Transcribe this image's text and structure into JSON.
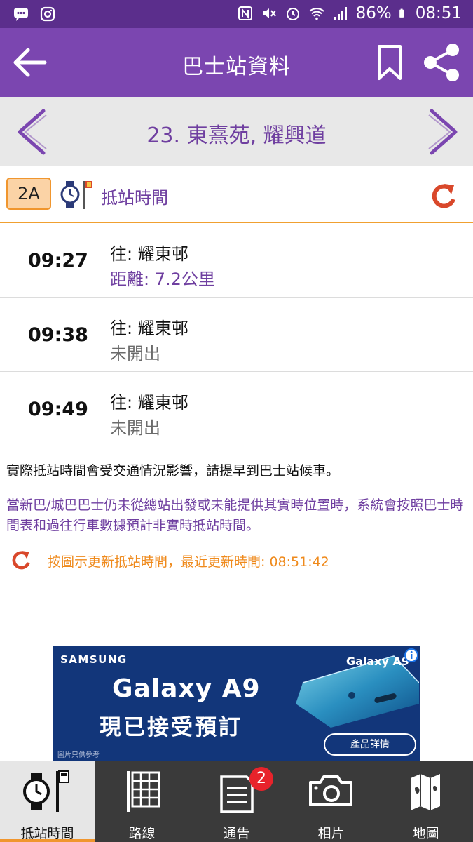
{
  "statusbar": {
    "battery": "86%",
    "time": "08:51",
    "icons": [
      "message-icon",
      "instagram-icon",
      "nfc-icon",
      "mute-icon",
      "alarm-icon",
      "wifi-icon",
      "signal-icon",
      "battery-icon"
    ]
  },
  "appbar": {
    "title": "巴士站資料",
    "icons": [
      "back-arrow-icon",
      "bookmark-icon",
      "share-icon"
    ]
  },
  "stop": {
    "name": "23.  東熹苑, 耀興道"
  },
  "route": {
    "number": "2A",
    "eta_title": "抵站時間"
  },
  "etas": [
    {
      "time": "09:27",
      "destination": "往: 耀東邨",
      "status": "距離: 7.2公里",
      "status_kind": "distance"
    },
    {
      "time": "09:38",
      "destination": "往: 耀東邨",
      "status": "未開出",
      "status_kind": "not_departed"
    },
    {
      "time": "09:49",
      "destination": "往: 耀東邨",
      "status": "未開出",
      "status_kind": "not_departed"
    }
  ],
  "notes": {
    "traffic": "實際抵站時間會受交通情況影響，請提早到巴士站候車。",
    "schedule": "當新巴/城巴巴士仍未從總站出發或未能提供其實時位置時，系統會按照巴士時間表和過往行車數據預計非實時抵站時間。",
    "last_update": "按圖示更新抵站時間，最近更新時間: 08:51:42"
  },
  "ad": {
    "brand": "SAMSUNG",
    "model": "Galaxy A9",
    "tagline": "現已接受預訂",
    "phone_label": "Galaxy A9",
    "disclaimer": "圖片只供參考",
    "cta": "產品詳情"
  },
  "bottomnav": {
    "items": [
      {
        "label": "抵站時間",
        "icon": "watch-stop-icon",
        "active": true
      },
      {
        "label": "路線",
        "icon": "route-list-icon",
        "active": false
      },
      {
        "label": "通告",
        "icon": "notice-icon",
        "active": false,
        "badge": "2"
      },
      {
        "label": "相片",
        "icon": "camera-icon",
        "active": false
      },
      {
        "label": "地圖",
        "icon": "map-icon",
        "active": false
      }
    ]
  },
  "colors": {
    "statusbar": "#5b2e8c",
    "appbar": "#7b46b0",
    "accent_purple": "#6f3fa0",
    "accent_orange": "#f0962e",
    "refresh_red": "#d9482b",
    "bottom_nav": "#3a3a3a",
    "badge_red": "#e8232b"
  }
}
